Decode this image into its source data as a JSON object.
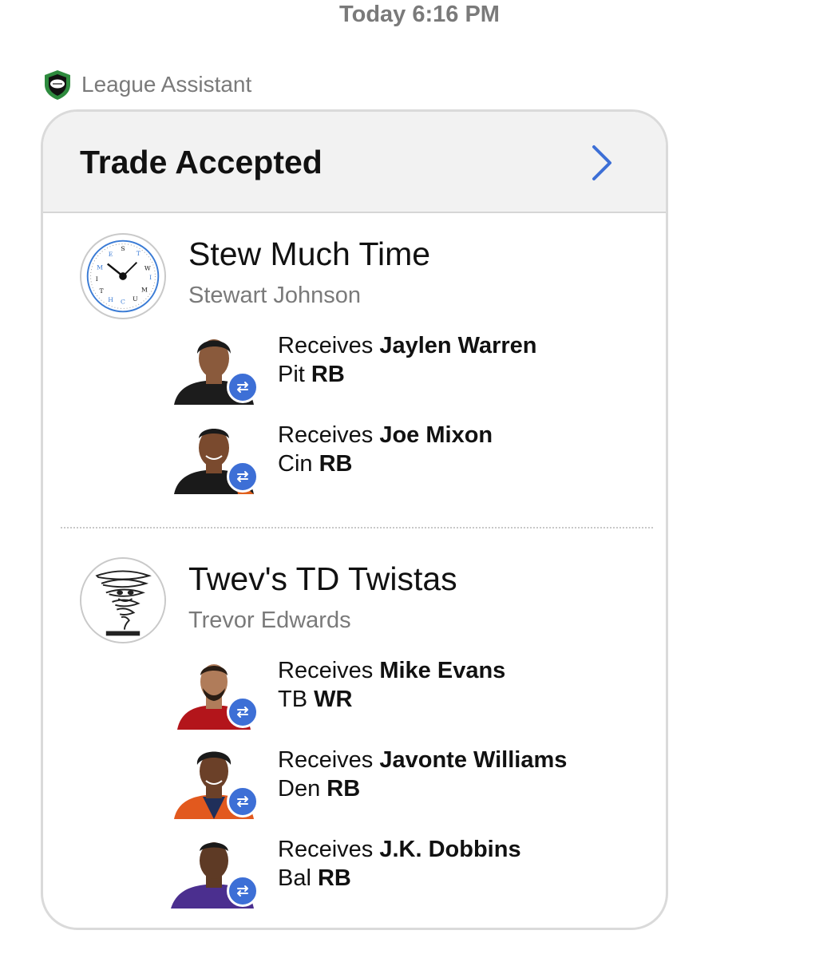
{
  "timestamp": "Today 6:16 PM",
  "sender": {
    "name": "League Assistant",
    "icon": "football-shield-icon"
  },
  "card": {
    "title": "Trade Accepted",
    "teams": [
      {
        "name": "Stew Much Time",
        "owner": "Stewart Johnson",
        "avatar_icon": "clock-icon",
        "players": [
          {
            "action": "Receives",
            "player": "Jaylen Warren",
            "team": "Pit",
            "position": "RB",
            "jersey_color": "#1c1c1c"
          },
          {
            "action": "Receives",
            "player": "Joe Mixon",
            "team": "Cin",
            "position": "RB",
            "jersey_color": "#1a1a1a"
          }
        ]
      },
      {
        "name": "Twev's TD Twistas",
        "owner": "Trevor Edwards",
        "avatar_icon": "tornado-icon",
        "players": [
          {
            "action": "Receives",
            "player": "Mike Evans",
            "team": "TB",
            "position": "WR",
            "jersey_color": "#b3151b"
          },
          {
            "action": "Receives",
            "player": "Javonte Williams",
            "team": "Den",
            "position": "RB",
            "jersey_color": "#e2591e"
          },
          {
            "action": "Receives",
            "player": "J.K. Dobbins",
            "team": "Bal",
            "position": "RB",
            "jersey_color": "#4b2f8f"
          }
        ]
      }
    ]
  },
  "colors": {
    "accent": "#3d6fd6",
    "muted": "#7a7a7a",
    "header_bg": "#f2f2f2"
  }
}
